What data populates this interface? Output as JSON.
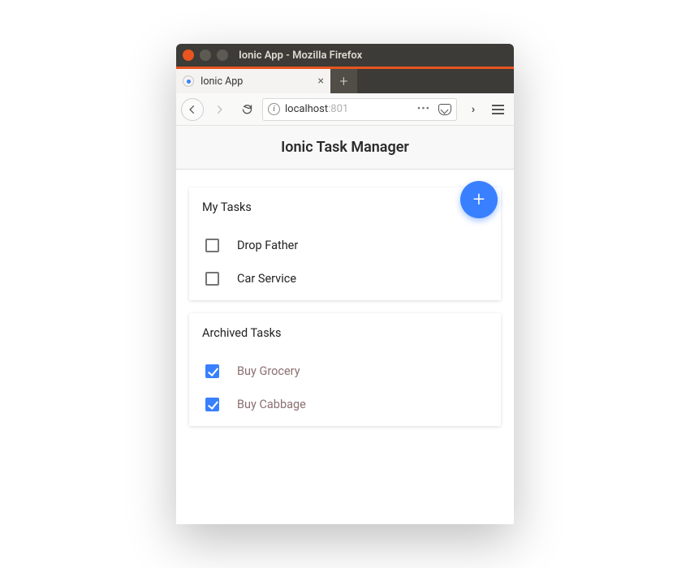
{
  "window": {
    "title": "Ionic App - Mozilla Firefox"
  },
  "tab": {
    "title": "Ionic App"
  },
  "urlbar": {
    "host": "localhost",
    "rest": ":801"
  },
  "app": {
    "header": "Ionic Task Manager"
  },
  "myTasks": {
    "title": "My Tasks",
    "items": [
      {
        "label": "Drop Father",
        "checked": false
      },
      {
        "label": "Car Service",
        "checked": false
      }
    ]
  },
  "archivedTasks": {
    "title": "Archived Tasks",
    "items": [
      {
        "label": "Buy Grocery",
        "checked": true
      },
      {
        "label": "Buy Cabbage",
        "checked": true
      }
    ]
  }
}
